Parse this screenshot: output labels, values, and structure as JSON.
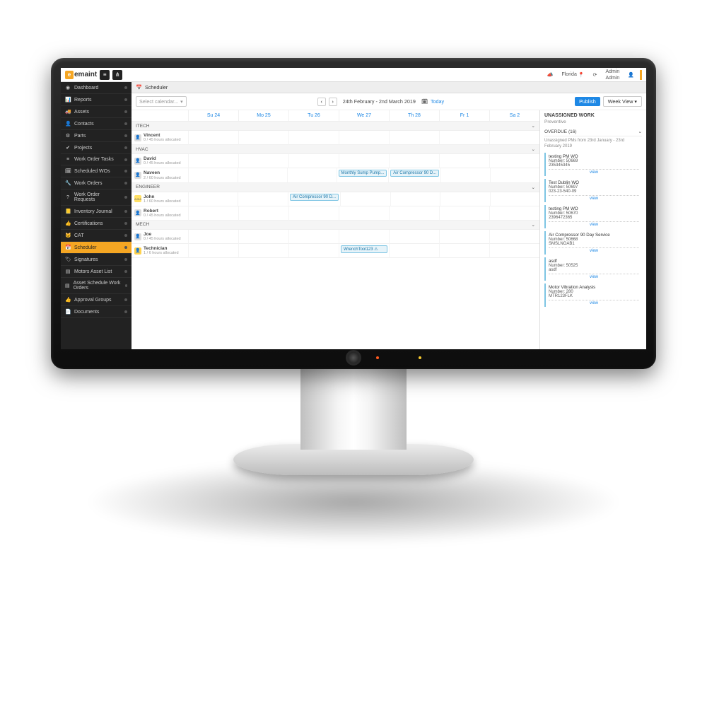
{
  "brand": "emaint",
  "header": {
    "loc": "Florida",
    "user_line1": "Admin",
    "user_line2": "Admin"
  },
  "sidebar": [
    {
      "icon": "◉",
      "label": "Dashboard"
    },
    {
      "icon": "📊",
      "label": "Reports"
    },
    {
      "icon": "🚚",
      "label": "Assets"
    },
    {
      "icon": "👤",
      "label": "Contacts"
    },
    {
      "icon": "⚙",
      "label": "Parts"
    },
    {
      "icon": "✔",
      "label": "Projects"
    },
    {
      "icon": "≡",
      "label": "Work Order Tasks"
    },
    {
      "icon": "🗓",
      "label": "Scheduled WOs"
    },
    {
      "icon": "🔧",
      "label": "Work Orders"
    },
    {
      "icon": "?",
      "label": "Work Order Requests"
    },
    {
      "icon": "📒",
      "label": "Inventory Journal"
    },
    {
      "icon": "👍",
      "label": "Certifications"
    },
    {
      "icon": "🐱",
      "label": "CAT"
    },
    {
      "icon": "📅",
      "label": "Scheduler",
      "active": true
    },
    {
      "icon": "🏷",
      "label": "Signatures"
    },
    {
      "icon": "▤",
      "label": "Motors Asset List"
    },
    {
      "icon": "▤",
      "label": "Asset Schedule Work Orders"
    },
    {
      "icon": "👍",
      "label": "Approval Groups"
    },
    {
      "icon": "📄",
      "label": "Documents"
    }
  ],
  "breadcrumb": {
    "icon": "📅",
    "title": "Scheduler"
  },
  "toolbar": {
    "calendar_placeholder": "Select calendar...",
    "range": "24th February - 2nd March 2019",
    "today": "Today",
    "publish": "Publish",
    "view": "Week View ▾"
  },
  "days": [
    "Su 24",
    "Mo 25",
    "Tu 26",
    "We 27",
    "Th 28",
    "Fr 1",
    "Sa 2"
  ],
  "groups": [
    {
      "name": "ITECH",
      "people": [
        {
          "name": "Vincent",
          "alloc": "0 / 45 hours allocated",
          "events": []
        }
      ]
    },
    {
      "name": "HVAC",
      "people": [
        {
          "name": "David",
          "alloc": "0 / 45 hours allocated",
          "events": []
        },
        {
          "name": "Naveen",
          "alloc": "2 / 60 hours allocated",
          "events": [
            {
              "day": 3,
              "text": "Monthly Sump Pump..."
            },
            {
              "day": 4,
              "text": "Air Compressor 90 D..."
            }
          ]
        }
      ]
    },
    {
      "name": "ENGINEER",
      "people": [
        {
          "name": "John",
          "alloc": "1 / 60 hours allocated",
          "avatar": "AJKA",
          "events": [
            {
              "day": 2,
              "text": "Air Compressor 90 D..."
            }
          ]
        },
        {
          "name": "Robert",
          "alloc": "0 / 45 hours allocated",
          "events": []
        }
      ]
    },
    {
      "name": "MECH",
      "people": [
        {
          "name": "Joe",
          "alloc": "0 / 45 hours allocated",
          "events": []
        },
        {
          "name": "Technician",
          "alloc": "1 / 6 hours allocated",
          "avatar": "yb",
          "events": [
            {
              "day": 3,
              "text": "WrenchTool123",
              "warn": true
            }
          ]
        }
      ]
    }
  ],
  "panel": {
    "title": "UNASSIGNED WORK",
    "sub": "Preventive",
    "overdue": "OVERDUE (16)",
    "overdue_note": "Unassigned PMs from 23rd January - 23rd February 2019",
    "cards": [
      {
        "t": "testing PM WO",
        "n": "Number: 50669",
        "c": "235345345"
      },
      {
        "t": "Test Dublin WO",
        "n": "Number: 50697",
        "c": "023-23-540-09"
      },
      {
        "t": "testing PM WO",
        "n": "Number: 50670",
        "c": "2396472365"
      },
      {
        "t": "Air Compressor 90 Day Service",
        "n": "Number: 50668",
        "c": "SMSLNOAB1"
      },
      {
        "t": "asdf",
        "n": "Number: 50525",
        "c": "asdf"
      },
      {
        "t": "Motor Vibration Analysis",
        "n": "Number: 280",
        "c": "MTR123FLK"
      }
    ],
    "view": "view"
  }
}
